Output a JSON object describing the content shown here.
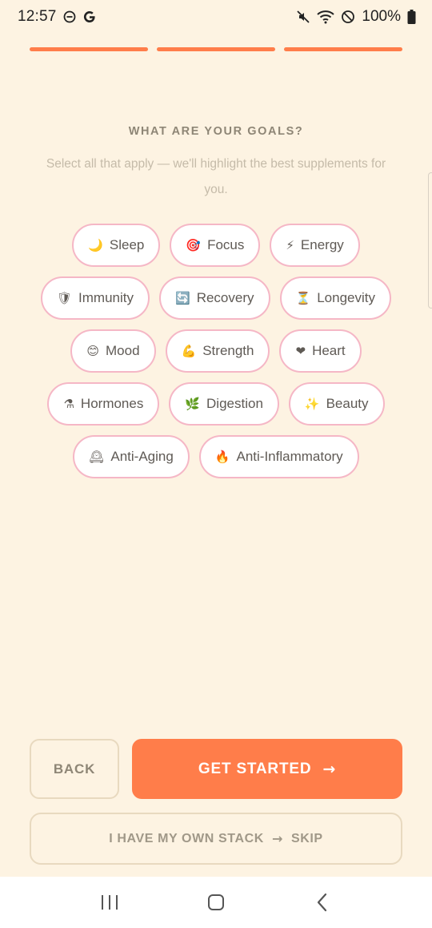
{
  "status_bar": {
    "time": "12:57",
    "battery": "100%",
    "icons": [
      "do-not-disturb-icon",
      "google-icon",
      "mute-icon",
      "wifi-icon",
      "block-icon",
      "battery-icon"
    ]
  },
  "progress": {
    "steps_total": 3,
    "steps_filled": 3,
    "color": "#FF7D4A"
  },
  "heading": "WHAT ARE YOUR GOALS?",
  "subtitle": "Select all that apply — we'll highlight the best supplements for you.",
  "goal_rows": [
    [
      {
        "emoji": "🌙",
        "label": "Sleep"
      },
      {
        "emoji": "🎯",
        "label": "Focus"
      },
      {
        "emoji": "⚡",
        "label": "Energy"
      }
    ],
    [
      {
        "emoji": "🛡",
        "label": "Immunity"
      },
      {
        "emoji": "🔄",
        "label": "Recovery"
      },
      {
        "emoji": "⏳",
        "label": "Longevity"
      }
    ],
    [
      {
        "emoji": "😊",
        "label": "Mood"
      },
      {
        "emoji": "💪",
        "label": "Strength"
      },
      {
        "emoji": "❤",
        "label": "Heart"
      }
    ],
    [
      {
        "emoji": "⚗",
        "label": "Hormones"
      },
      {
        "emoji": "🌿",
        "label": "Digestion"
      },
      {
        "emoji": "✨",
        "label": "Beauty"
      }
    ],
    [
      {
        "emoji": "🕰",
        "label": "Anti-Aging"
      },
      {
        "emoji": "🔥",
        "label": "Anti-Inflammatory"
      }
    ]
  ],
  "buttons": {
    "back": "BACK",
    "get_started": "GET STARTED",
    "get_started_arrow": "→",
    "skip_left": "I HAVE MY OWN STACK",
    "skip_arrow": "→",
    "skip_right": "SKIP"
  },
  "colors": {
    "background": "#FDF3E2",
    "accent": "#FF7D4A",
    "chip_border": "#F5B7C6",
    "muted_text": "#8E8676"
  }
}
